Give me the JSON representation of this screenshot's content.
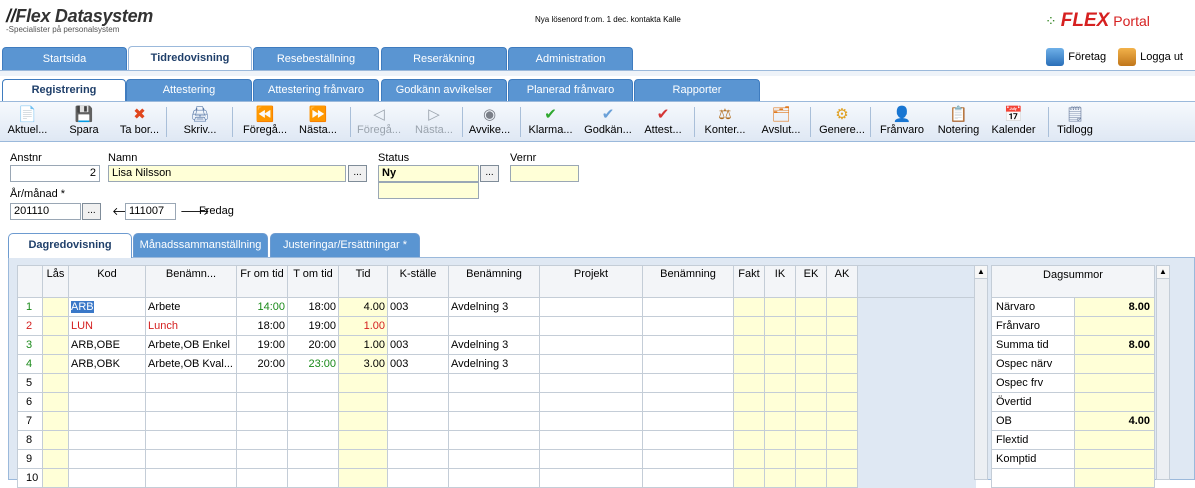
{
  "header": {
    "logo_text": "Flex Datasystem",
    "tagline": "-Specialister på personalsystem",
    "notice": "Nya lösenord fr.om. 1 dec. kontakta Kalle",
    "portal_brand": "FLEX",
    "portal_word": "Portal",
    "company_label": "Företag",
    "logout_label": "Logga ut"
  },
  "main_tabs": [
    "Startsida",
    "Tidredovisning",
    "Resebeställning",
    "Reseräkning",
    "Administration"
  ],
  "sub_tabs": [
    "Registrering",
    "Attestering",
    "Attestering frånvaro",
    "Godkänn avvikelser",
    "Planerad frånvaro",
    "Rapporter"
  ],
  "toolbar": [
    {
      "label": "Aktuel...",
      "icon": "document-icon",
      "glyph": "📄",
      "color": "#6d8fc4"
    },
    {
      "label": "Spara",
      "icon": "save-icon",
      "glyph": "💾",
      "color": "#2f7fd0"
    },
    {
      "label": "Ta bor...",
      "icon": "delete-icon",
      "glyph": "✖",
      "color": "#e0461d"
    },
    {
      "label": "Skriv...",
      "icon": "print-icon",
      "glyph": "🖨",
      "color": "#5a7aa8"
    },
    {
      "label": "Föregå...",
      "icon": "rewind-icon",
      "glyph": "⏪",
      "color": "#e8b816"
    },
    {
      "label": "Nästa...",
      "icon": "fast-forward-icon",
      "glyph": "⏩",
      "color": "#e8b816"
    },
    {
      "label": "Föregå...",
      "icon": "prev-icon",
      "glyph": "◁",
      "color": "#9aa3ad"
    },
    {
      "label": "Nästa...",
      "icon": "next-icon",
      "glyph": "▷",
      "color": "#9aa3ad"
    },
    {
      "label": "Avvike...",
      "icon": "deviation-icon",
      "glyph": "◉",
      "color": "#7a7f88"
    },
    {
      "label": "Klarma...",
      "icon": "checkmark-green-icon",
      "glyph": "✔",
      "color": "#2fa82f"
    },
    {
      "label": "Godkän...",
      "icon": "checkmark-blue-icon",
      "glyph": "✔",
      "color": "#6aa0d8"
    },
    {
      "label": "Attest...",
      "icon": "checkmark-red-icon",
      "glyph": "✔",
      "color": "#d43535"
    },
    {
      "label": "Konter...",
      "icon": "account-icon",
      "glyph": "⚖",
      "color": "#b06b1a"
    },
    {
      "label": "Avslut...",
      "icon": "close-period-icon",
      "glyph": "🗂",
      "color": "#e07a20"
    },
    {
      "label": "Genere...",
      "icon": "generate-icon",
      "glyph": "⚙",
      "color": "#e0a020"
    },
    {
      "label": "Frånvaro",
      "icon": "absence-icon",
      "glyph": "👤",
      "color": "#5a6fb0"
    },
    {
      "label": "Notering",
      "icon": "note-icon",
      "glyph": "📋",
      "color": "#4a7fc4"
    },
    {
      "label": "Kalender",
      "icon": "calendar-icon",
      "glyph": "📅",
      "color": "#c04070"
    },
    {
      "label": "Tidlogg",
      "icon": "timelog-icon",
      "glyph": "🗒",
      "color": "#6d7fa0"
    }
  ],
  "form": {
    "anstnr_label": "Anstnr",
    "anstnr_value": "2",
    "namn_label": "Namn",
    "namn_value": "Lisa Nilsson",
    "status_label": "Status",
    "status_value": "Ny",
    "vernr_label": "Vernr",
    "vernr_value": "",
    "arman_label": "År/månad *",
    "arman_value": "201110",
    "date_value": "111007",
    "weekday": "Fredag",
    "dots": "..."
  },
  "lower_tabs": [
    "Dagredovisning",
    "Månadssammanställning",
    "Justeringar/Ersättningar *"
  ],
  "grid": {
    "headers": [
      "",
      "Lås",
      "Kod",
      "Benämn...",
      "Fr om tid",
      "T om tid",
      "Tid",
      "K-ställe",
      "Benämning",
      "Projekt",
      "Benämning",
      "Fakt",
      "IK",
      "EK",
      "AK",
      ""
    ],
    "rows": [
      {
        "n": "1",
        "kod": "ARB",
        "ben": "Arbete",
        "from": "14:00",
        "tom": "18:00",
        "tid": "4.00",
        "kst": "003",
        "kben": "Avdelning 3",
        "color": "black",
        "from_color": "#1a8a1a",
        "tom_color": "black",
        "tid_color": "black"
      },
      {
        "n": "2",
        "kod": "LUN",
        "ben": "Lunch",
        "from": "18:00",
        "tom": "19:00",
        "tid": "1.00",
        "kst": "",
        "kben": "",
        "color": "#d42020",
        "from_color": "black",
        "tom_color": "black",
        "tid_color": "#d42020"
      },
      {
        "n": "3",
        "kod": "ARB,OBE",
        "ben": "Arbete,OB Enkel",
        "from": "19:00",
        "tom": "20:00",
        "tid": "1.00",
        "kst": "003",
        "kben": "Avdelning 3",
        "color": "black",
        "from_color": "black",
        "tom_color": "black",
        "tid_color": "black"
      },
      {
        "n": "4",
        "kod": "ARB,OBK",
        "ben": "Arbete,OB Kval...",
        "from": "20:00",
        "tom": "23:00",
        "tid": "3.00",
        "kst": "003",
        "kben": "Avdelning 3",
        "color": "black",
        "from_color": "black",
        "tom_color": "#1a8a1a",
        "tid_color": "black"
      },
      {
        "n": "5",
        "kod": "",
        "ben": "",
        "from": "",
        "tom": "",
        "tid": "",
        "kst": "",
        "kben": "",
        "color": "black",
        "from_color": "black",
        "tom_color": "black",
        "tid_color": "black"
      },
      {
        "n": "6",
        "kod": "",
        "ben": "",
        "from": "",
        "tom": "",
        "tid": "",
        "kst": "",
        "kben": "",
        "color": "black",
        "from_color": "black",
        "tom_color": "black",
        "tid_color": "black"
      },
      {
        "n": "7",
        "kod": "",
        "ben": "",
        "from": "",
        "tom": "",
        "tid": "",
        "kst": "",
        "kben": "",
        "color": "black",
        "from_color": "black",
        "tom_color": "black",
        "tid_color": "black"
      },
      {
        "n": "8",
        "kod": "",
        "ben": "",
        "from": "",
        "tom": "",
        "tid": "",
        "kst": "",
        "kben": "",
        "color": "black",
        "from_color": "black",
        "tom_color": "black",
        "tid_color": "black"
      },
      {
        "n": "9",
        "kod": "",
        "ben": "",
        "from": "",
        "tom": "",
        "tid": "",
        "kst": "",
        "kben": "",
        "color": "black",
        "from_color": "black",
        "tom_color": "black",
        "tid_color": "black"
      },
      {
        "n": "10",
        "kod": "",
        "ben": "",
        "from": "",
        "tom": "",
        "tid": "",
        "kst": "",
        "kben": "",
        "color": "black",
        "from_color": "black",
        "tom_color": "black",
        "tid_color": "black"
      }
    ]
  },
  "summary": {
    "title": "Dagsummor",
    "rows": [
      {
        "label": "Närvaro",
        "value": "8.00"
      },
      {
        "label": "Frånvaro",
        "value": ""
      },
      {
        "label": "Summa tid",
        "value": "8.00"
      },
      {
        "label": "Ospec närv",
        "value": ""
      },
      {
        "label": "Ospec frv",
        "value": ""
      },
      {
        "label": "Övertid",
        "value": ""
      },
      {
        "label": "OB",
        "value": "4.00"
      },
      {
        "label": "Flextid",
        "value": ""
      },
      {
        "label": "Komptid",
        "value": ""
      },
      {
        "label": "",
        "value": ""
      }
    ]
  }
}
